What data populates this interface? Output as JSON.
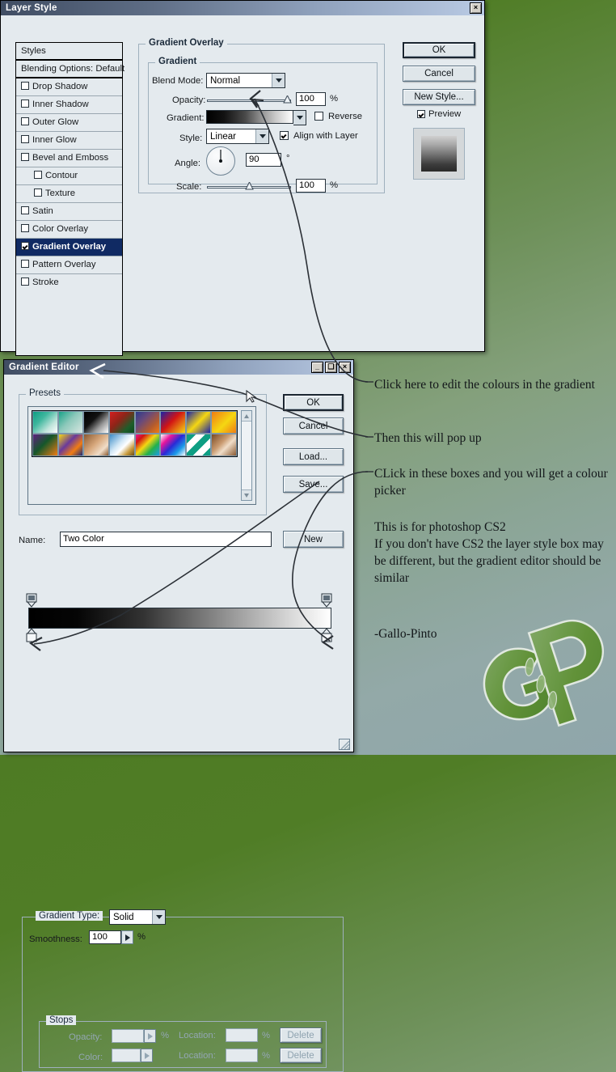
{
  "layer_style": {
    "title": "Layer Style",
    "close_label": "×",
    "styles_panel": {
      "header": "Styles",
      "items": [
        {
          "label": "Blending Options: Default",
          "checkbox": false,
          "sub": false,
          "selected": false,
          "header": true
        },
        {
          "label": "Drop Shadow",
          "checkbox": false,
          "sub": false,
          "selected": false
        },
        {
          "label": "Inner Shadow",
          "checkbox": false,
          "sub": false,
          "selected": false
        },
        {
          "label": "Outer Glow",
          "checkbox": false,
          "sub": false,
          "selected": false
        },
        {
          "label": "Inner Glow",
          "checkbox": false,
          "sub": false,
          "selected": false
        },
        {
          "label": "Bevel and Emboss",
          "checkbox": false,
          "sub": false,
          "selected": false
        },
        {
          "label": "Contour",
          "checkbox": false,
          "sub": true,
          "selected": false
        },
        {
          "label": "Texture",
          "checkbox": false,
          "sub": true,
          "selected": false
        },
        {
          "label": "Satin",
          "checkbox": false,
          "sub": false,
          "selected": false
        },
        {
          "label": "Color Overlay",
          "checkbox": false,
          "sub": false,
          "selected": false
        },
        {
          "label": "Gradient Overlay",
          "checkbox": true,
          "sub": false,
          "selected": true
        },
        {
          "label": "Pattern Overlay",
          "checkbox": false,
          "sub": false,
          "selected": false
        },
        {
          "label": "Stroke",
          "checkbox": false,
          "sub": false,
          "selected": false
        }
      ]
    },
    "gradient_overlay": {
      "group_title": "Gradient Overlay",
      "sub_group_title": "Gradient",
      "blend_mode_label": "Blend Mode:",
      "blend_mode_value": "Normal",
      "opacity_label": "Opacity:",
      "opacity_value": "100",
      "opacity_unit": "%",
      "gradient_label": "Gradient:",
      "reverse_label": "Reverse",
      "reverse_checked": false,
      "style_label": "Style:",
      "style_value": "Linear",
      "align_label": "Align with Layer",
      "align_checked": true,
      "angle_label": "Angle:",
      "angle_value": "90",
      "angle_unit": "°",
      "scale_label": "Scale:",
      "scale_value": "100",
      "scale_unit": "%"
    },
    "buttons": {
      "ok": "OK",
      "cancel": "Cancel",
      "new_style": "New Style...",
      "preview_label": "Preview",
      "preview_checked": true
    }
  },
  "gradient_editor": {
    "title": "Gradient Editor",
    "minimize_label": "_",
    "maximize_label": "❑",
    "close_label": "×",
    "presets_label": "Presets",
    "presets": [
      {
        "name": "teal-to-white",
        "css": "linear-gradient(135deg,#0e9e83 0%,#3fb79e 35%,#bfe4db 70%,#ffffff 100%)"
      },
      {
        "name": "teal-to-transparent",
        "css": "linear-gradient(135deg,#1ba389 0%,#8ec9bb 45%,#d8e6e2 100%)"
      },
      {
        "name": "black-to-white",
        "css": "linear-gradient(135deg,#000000 0%,#111111 38%,#9a9a9a 68%,#ffffff 100%)"
      },
      {
        "name": "red-green",
        "css": "linear-gradient(135deg,#d31f1f 0%,#8e2418 40%,#1d5e2a 75%,#0c4a1e 100%)"
      },
      {
        "name": "violet-orange",
        "css": "linear-gradient(135deg,#2b3a8c 0%,#6a4a7a 35%,#b35b2e 70%,#f07c14 100%)"
      },
      {
        "name": "blue-red-yellow",
        "css": "linear-gradient(135deg,#1b23a8 0%,#d21414 45%,#f5d712 100%)"
      },
      {
        "name": "blue-yellow-blue",
        "css": "linear-gradient(135deg,#1b23a8 0%,#f5d712 50%,#1b23a8 100%)"
      },
      {
        "name": "orange-yellow",
        "css": "linear-gradient(135deg,#f07c14 0%,#f5d712 55%,#f07c14 100%)"
      },
      {
        "name": "violet-green-orange",
        "css": "linear-gradient(135deg,#5f2080 0%,#14572a 45%,#f07c14 100%)"
      },
      {
        "name": "yellow-violet-orange-blue",
        "css": "linear-gradient(135deg,#f5d712 0%,#6a3a9b 40%,#f07c14 70%,#1b2a7a 100%)"
      },
      {
        "name": "copper",
        "css": "linear-gradient(135deg,#8a5a32 0%,#d7a77b 45%,#f0ddc8 75%,#8a5a32 100%)"
      },
      {
        "name": "chrome",
        "css": "linear-gradient(135deg,#3d8cc7 0%,#cfe6f5 40%,#ffffff 58%,#c79a3c 80%,#6b4e16 100%)"
      },
      {
        "name": "spectrum",
        "css": "linear-gradient(135deg,#e8169b 0%,#d21414 20%,#f5d712 45%,#22b14c 70%,#1b9be8 100%)"
      },
      {
        "name": "transparent-rainbow",
        "css": "linear-gradient(135deg,#ffffff 0%,#e8169b 25%,#2a2ad6 50%,#1b9be8 75%,#ffffff 100%)"
      },
      {
        "name": "teal-stripes",
        "css": "repeating-linear-gradient(135deg,#0e9e83 0 8px,#ffffff 8px 16px)"
      },
      {
        "name": "copper-2",
        "css": "linear-gradient(135deg,#7a4a22 0%,#c99a70 40%,#f0ddc8 60%,#8a5a32 100%)"
      }
    ],
    "buttons": {
      "ok": "OK",
      "cancel": "Cancel",
      "load": "Load...",
      "save": "Save...",
      "new": "New"
    },
    "name_label": "Name:",
    "name_value": "Two Color",
    "gradient_type_label": "Gradient Type:",
    "gradient_type_value": "Solid",
    "smoothness_label": "Smoothness:",
    "smoothness_value": "100",
    "smoothness_unit": "%",
    "stops_label": "Stops",
    "opacity_label": "Opacity:",
    "opacity_value": "",
    "opacity_unit": "%",
    "color_label": "Color:",
    "color_value": "",
    "location_label_1": "Location:",
    "location_value_1": "",
    "location_unit_1": "%",
    "location_label_2": "Location:",
    "location_value_2": "",
    "location_unit_2": "%",
    "delete_label_1": "Delete",
    "delete_label_2": "Delete"
  },
  "annotations": {
    "line1": "Click here to edit the colours in the gradient",
    "line2": "Then this will pop up",
    "line3": "CLick in these boxes and you will get a colour picker",
    "line4": "This is for photoshop CS2\nIf you don't have CS2 the layer style box may be different, but the gradient editor should be similar",
    "line5": "-Gallo-Pinto"
  },
  "colors": {
    "background_top": "#4e7b24",
    "background_bottom": "#8fa6ab",
    "dialog_face": "#e4eaee",
    "selection": "#102a63",
    "title_bar_left": "#404d63",
    "title_bar_right": "#b9cae4"
  }
}
